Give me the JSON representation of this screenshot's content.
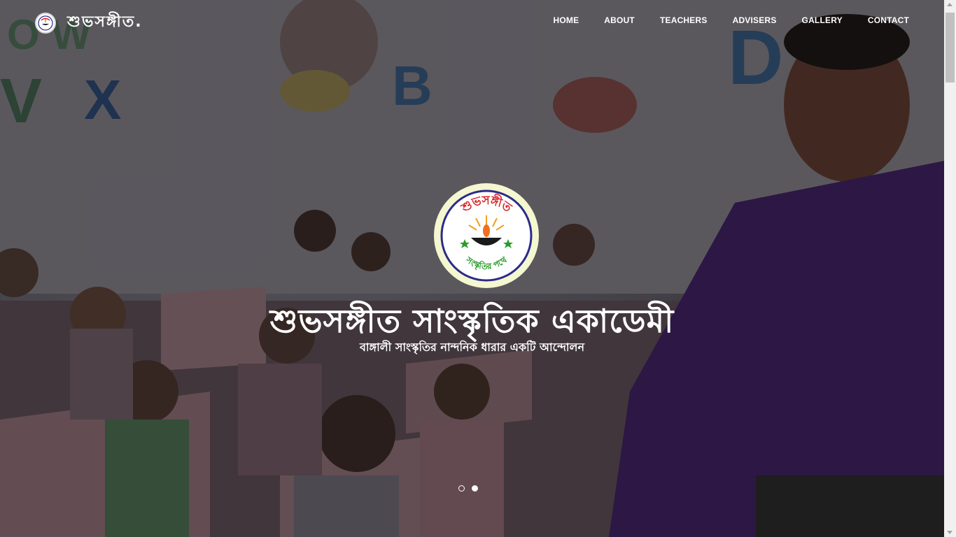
{
  "brand": {
    "name": "শুভসঙ্গীত.",
    "logo_icon": "academy-emblem-icon"
  },
  "nav": [
    {
      "label": "HOME"
    },
    {
      "label": "ABOUT"
    },
    {
      "label": "TEACHERS"
    },
    {
      "label": "ADVISERS"
    },
    {
      "label": "GALLERY"
    },
    {
      "label": "CONTACT"
    }
  ],
  "hero": {
    "logo_top_text": "শুভসঙ্গীত",
    "logo_bottom_text": "সংস্কৃতির পথে",
    "title": "শুভসঙ্গীত সাংস্কৃতিক একাডেমী",
    "subtitle": "বাঙ্গালী সাংস্কৃতির নান্দনিক ধারার একটি আন্দোলন",
    "background_image": "classroom-music-lesson-photo"
  },
  "carousel": {
    "slides": 2,
    "active": 2
  },
  "colors": {
    "nav_text": "#ffffff",
    "logo_ring": "#f4f7cf",
    "logo_border": "#2b2b8a",
    "logo_text_red": "#d8262a",
    "logo_text_green": "#2a9a2a"
  }
}
